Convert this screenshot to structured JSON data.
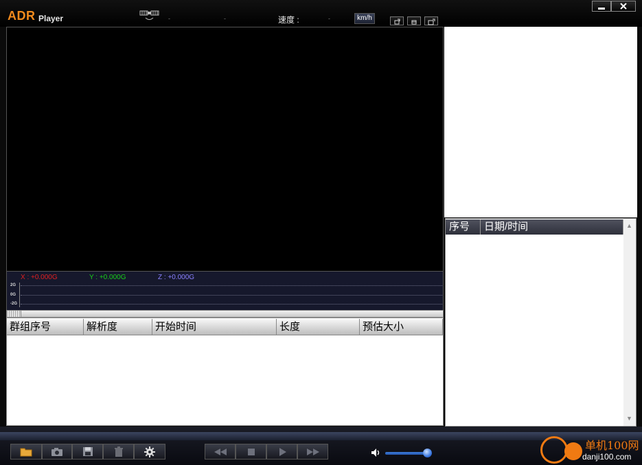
{
  "app": {
    "logo_brand": "ADR",
    "logo_name": "Player"
  },
  "header": {
    "gps_dash1": "-",
    "gps_dash2": "-",
    "speed_label": "速度 :",
    "speed_value": "-",
    "speed_unit": "km/h"
  },
  "gsensor": {
    "x_label": "X : +0.000G",
    "y_label": "Y : +0.000G",
    "z_label": "Z : +0.000G",
    "scale_top": "2G",
    "scale_mid": "0G",
    "scale_bottom": "-2G",
    "colors": {
      "x": "#e02020",
      "y": "#18d018",
      "z": "#8a80ff"
    }
  },
  "group_table": {
    "columns": [
      "群组序号",
      "解析度",
      "开始时间",
      "长度",
      "预估大小"
    ],
    "rows": []
  },
  "file_list": {
    "columns": [
      "序号",
      "日期/时间"
    ],
    "rows": []
  },
  "toolbar": {
    "left_buttons": [
      "folder-icon",
      "camera-icon",
      "save-icon",
      "trash-icon",
      "gear-icon"
    ],
    "playback_buttons": [
      "rewind-icon",
      "stop-icon",
      "play-icon",
      "fast-forward-icon"
    ],
    "volume_level": 0.9
  },
  "watermark": {
    "line1": "单机100网",
    "line2": "danji100.com"
  },
  "colors": {
    "brand_orange": "#f08a1c",
    "accent_blue": "#3b78e0"
  }
}
